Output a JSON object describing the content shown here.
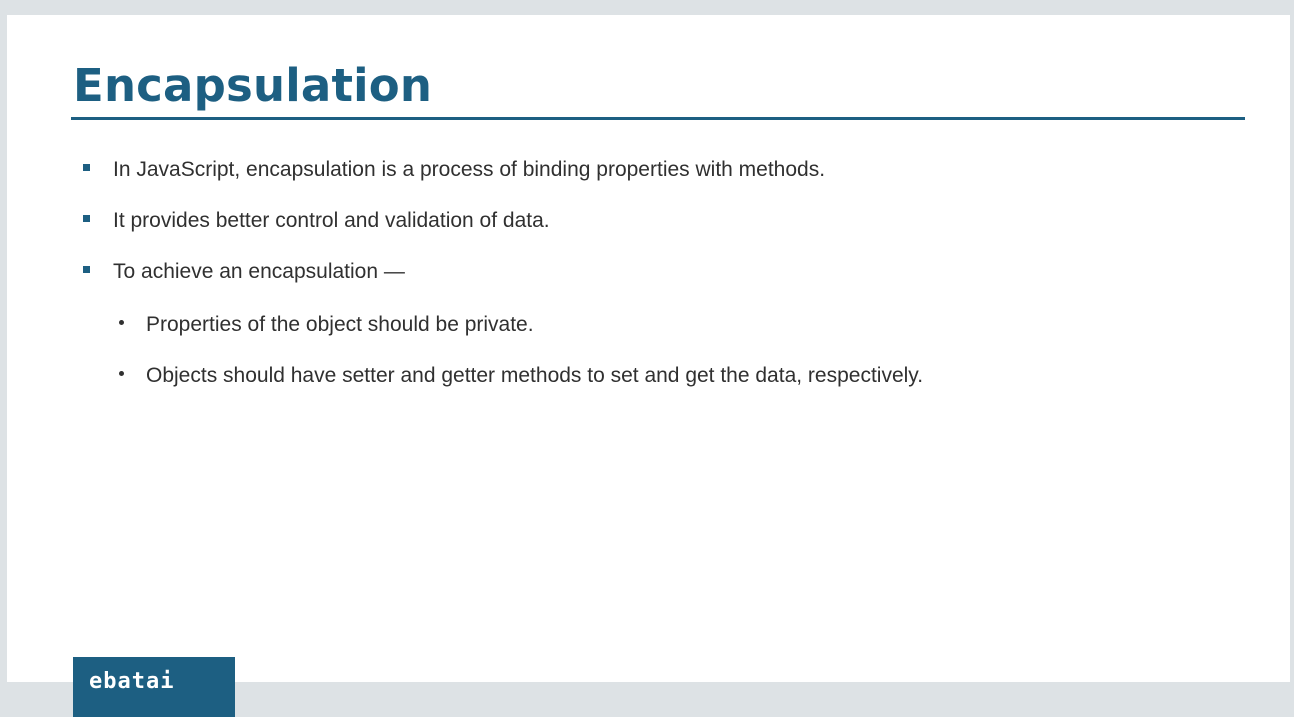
{
  "slide": {
    "title": "Encapsulation",
    "bullets": [
      {
        "level": 1,
        "text": "In JavaScript, encapsulation is a process of binding properties with methods."
      },
      {
        "level": 1,
        "text": "It provides better control and validation of data."
      },
      {
        "level": 1,
        "text": "To achieve an encapsulation —"
      },
      {
        "level": 2,
        "text": "Properties of the object should be private."
      },
      {
        "level": 2,
        "text": "Objects should have setter and getter methods to set and get the data, respectively."
      }
    ]
  },
  "logo": {
    "text": "ebatai"
  },
  "colors": {
    "accent": "#1d5f82",
    "body_text": "#303030",
    "background": "#dde2e5",
    "slide": "#ffffff"
  },
  "icons": {
    "level1_bullet": "square-bullet-icon",
    "level2_bullet": "round-bullet-icon"
  }
}
